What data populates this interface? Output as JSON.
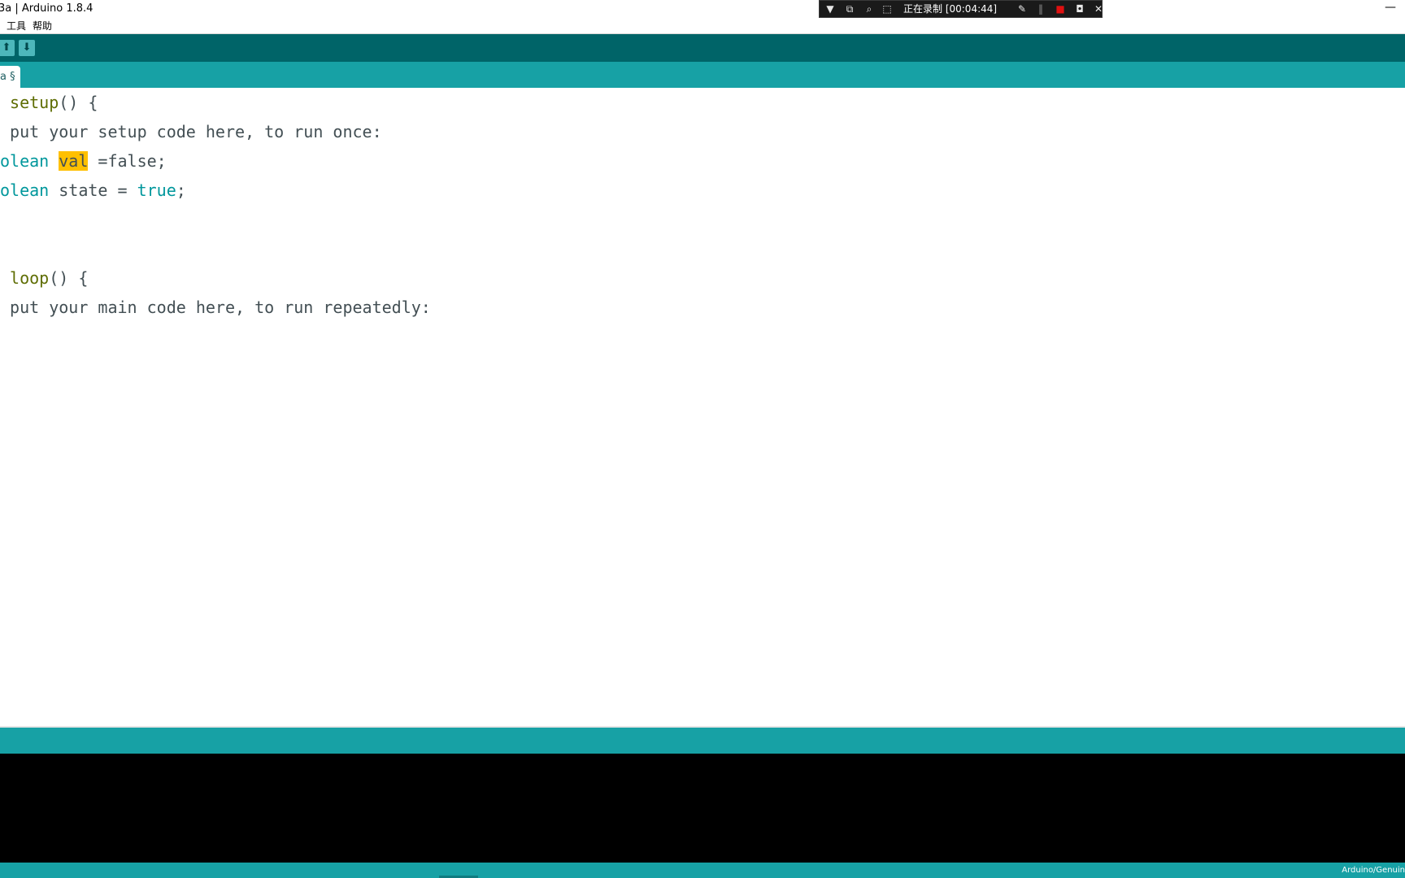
{
  "window": {
    "title": "3a | Arduino 1.8.4",
    "minimize_glyph": "—"
  },
  "recorder": {
    "status_text": "正在录制 [00:04:44]",
    "icons": [
      "dropdown-icon",
      "restore-icon",
      "zoom-icon",
      "region-icon",
      "pen-icon",
      "pause-icon",
      "stop-icon",
      "camera-icon",
      "close-icon"
    ]
  },
  "menu": {
    "items": [
      "工具",
      "帮助"
    ]
  },
  "toolbar": {
    "open_glyph": "⬆",
    "save_glyph": "⬇"
  },
  "tabs": [
    {
      "label": "a §"
    }
  ],
  "editor": {
    "lines": {
      "l1_func": "setup",
      "l1_rest": "() {",
      "l2": "put your setup code here, to run once:",
      "l3_type": "olean",
      "l3_var": "val",
      "l3_rest": " =false;",
      "l4_type": "olean",
      "l4_mid": " state = ",
      "l4_lit": "true",
      "l4_end": ";",
      "l7_func": "loop",
      "l7_rest": "() {",
      "l8": "put your main code here, to run repeatedly:"
    }
  },
  "footer": {
    "board": "Arduino/Genuin"
  },
  "colors": {
    "toolbar": "#006468",
    "tabbar": "#17a1a5",
    "keyword_type": "#00979c",
    "keyword_func": "#5e6d03",
    "highlight": "#ffc000",
    "console": "#000000"
  }
}
